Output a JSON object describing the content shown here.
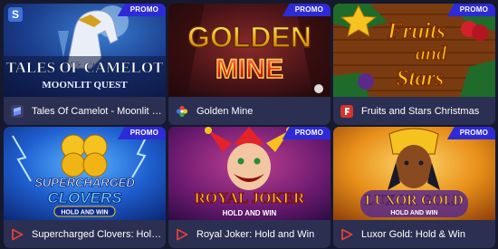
{
  "games": [
    {
      "title": "Tales Of Camelot - Moonlit Quest",
      "title_display": "Tales Of Camelot - Moonlit Q...",
      "badge": "PROMO",
      "art_line1": "TALES OF CAMELOT",
      "art_line2": "MOONLIT QUEST",
      "provider_icon": "provider-s-icon"
    },
    {
      "title": "Golden Mine",
      "title_display": "Golden Mine",
      "badge": "PROMO",
      "art_line1": "GOLDEN",
      "art_line2": "MINE",
      "provider_icon": "provider-flower-icon"
    },
    {
      "title": "Fruits and Stars Christmas",
      "title_display": "Fruits and Stars Christmas",
      "badge": "PROMO",
      "art_line1": "Fruits",
      "art_line2": "and",
      "art_line3": "Stars",
      "provider_icon": "provider-f-icon"
    },
    {
      "title": "Supercharged Clovers: Hold and Win",
      "title_display": "Supercharged Clovers: Hold ...",
      "badge": "PROMO",
      "art_line1": "SUPERCHARGED",
      "art_line2": "CLOVERS",
      "art_line3": "HOLD AND WIN",
      "provider_icon": "provider-play-icon"
    },
    {
      "title": "Royal Joker: Hold and Win",
      "title_display": "Royal Joker: Hold and Win",
      "badge": "PROMO",
      "art_line1": "ROYAL JOKER",
      "art_line2": "HOLD AND WIN",
      "provider_icon": "provider-play-icon"
    },
    {
      "title": "Luxor Gold: Hold & Win",
      "title_display": "Luxor Gold: Hold & Win",
      "badge": "PROMO",
      "art_line1": "LUXOR GOLD",
      "art_line2": "HOLD AND WIN",
      "provider_icon": "provider-play-icon"
    }
  ],
  "colors": {
    "page_background": "#16192e",
    "card_background": "#2b2f52",
    "promo_badge": "#2d2bd8",
    "provider_play": "#e0403a",
    "provider_f": "#d8342c"
  }
}
